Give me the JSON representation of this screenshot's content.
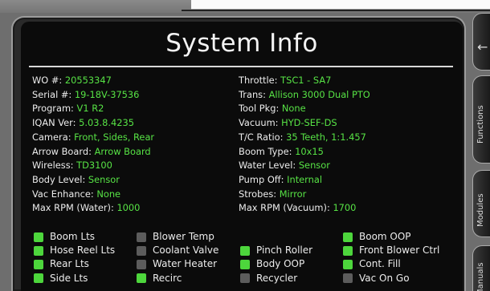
{
  "title": "System Info",
  "info_left": [
    {
      "label": "WO #:",
      "value": "20553347"
    },
    {
      "label": "Serial #:",
      "value": "19-18V-37536"
    },
    {
      "label": "Program:",
      "value": "V1 R2"
    },
    {
      "label": "IQAN Ver:",
      "value": "5.03.8.4235"
    },
    {
      "label": "Camera:",
      "value": "Front, Sides, Rear"
    },
    {
      "label": "Arrow Board:",
      "value": "Arrow Board"
    },
    {
      "label": "Wireless:",
      "value": "TD3100"
    },
    {
      "label": "Body Level:",
      "value": "Sensor"
    },
    {
      "label": "Vac Enhance:",
      "value": "None"
    },
    {
      "label": "Max RPM (Water):",
      "value": "1000"
    }
  ],
  "info_right": [
    {
      "label": "Throttle:",
      "value": "TSC1 - SA7"
    },
    {
      "label": "Trans:",
      "value": "Allison 3000 Dual PTO"
    },
    {
      "label": "Tool Pkg:",
      "value": "None"
    },
    {
      "label": "Vacuum:",
      "value": "HYD-SEF-DS"
    },
    {
      "label": "T/C Ratio:",
      "value": "35 Teeth, 1:1.457"
    },
    {
      "label": "Boom Type:",
      "value": "10x15"
    },
    {
      "label": "Water Level:",
      "value": "Sensor"
    },
    {
      "label": "Pump Off:",
      "value": "Internal"
    },
    {
      "label": "Strobes:",
      "value": "Mirror"
    },
    {
      "label": "Max RPM (Vacuum):",
      "value": "1700"
    }
  ],
  "indicators": {
    "col1": [
      {
        "label": "Boom Lts",
        "on": true
      },
      {
        "label": "Hose Reel Lts",
        "on": true
      },
      {
        "label": "Rear Lts",
        "on": true
      },
      {
        "label": "Side Lts",
        "on": true
      }
    ],
    "col2": [
      {
        "label": "Blower Temp",
        "on": false
      },
      {
        "label": "Coolant Valve",
        "on": false
      },
      {
        "label": "Water Heater",
        "on": false
      },
      {
        "label": "Recirc",
        "on": true
      }
    ],
    "col3": [
      {
        "label": "Pinch Roller",
        "on": true
      },
      {
        "label": "Body OOP",
        "on": true
      },
      {
        "label": "Recycler",
        "on": false
      }
    ],
    "col4": [
      {
        "label": "Boom OOP",
        "on": true
      },
      {
        "label": "Front Blower Ctrl",
        "on": true
      },
      {
        "label": "Cont. Fill",
        "on": true
      },
      {
        "label": "Vac On Go",
        "on": false
      }
    ]
  },
  "side_tabs": {
    "back_icon": "back-arrow-icon",
    "functions": "Functions",
    "modules": "Modules",
    "manuals": "Manuals"
  },
  "colors": {
    "value_green": "#57e345",
    "led_on": "#4dd63c",
    "led_off": "#5c5c5c"
  }
}
